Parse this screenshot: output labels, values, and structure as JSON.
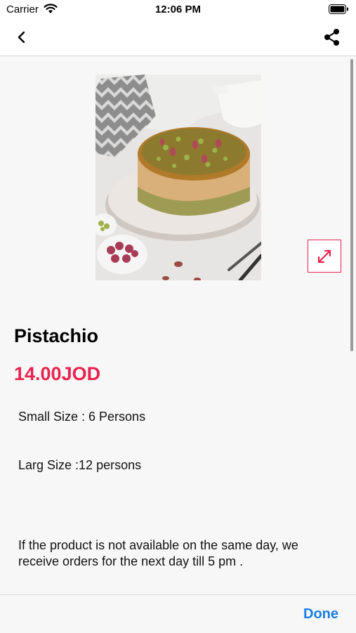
{
  "status_bar": {
    "carrier": "Carrier",
    "time": "12:06 PM",
    "wifi_icon": "wifi-icon",
    "battery_icon": "battery-icon"
  },
  "nav_bar": {
    "back_icon": "chevron-left-icon",
    "share_icon": "share-icon"
  },
  "product": {
    "image": "pistachio-cheesecake-photo",
    "name": "Pistachio",
    "price": "14.00JOD",
    "description": [
      "Small Size : 6 Persons",
      "Larg Size :12 persons",
      "If the product is not available on the same day, we",
      "receive orders for the next day till 5 pm ."
    ]
  },
  "expand_icon": "expand-arrows-icon",
  "footer": {
    "done_label": "Done"
  },
  "colors": {
    "accent": "#e8234f",
    "link": "#1a7ee6",
    "background": "#f7f7f7"
  }
}
